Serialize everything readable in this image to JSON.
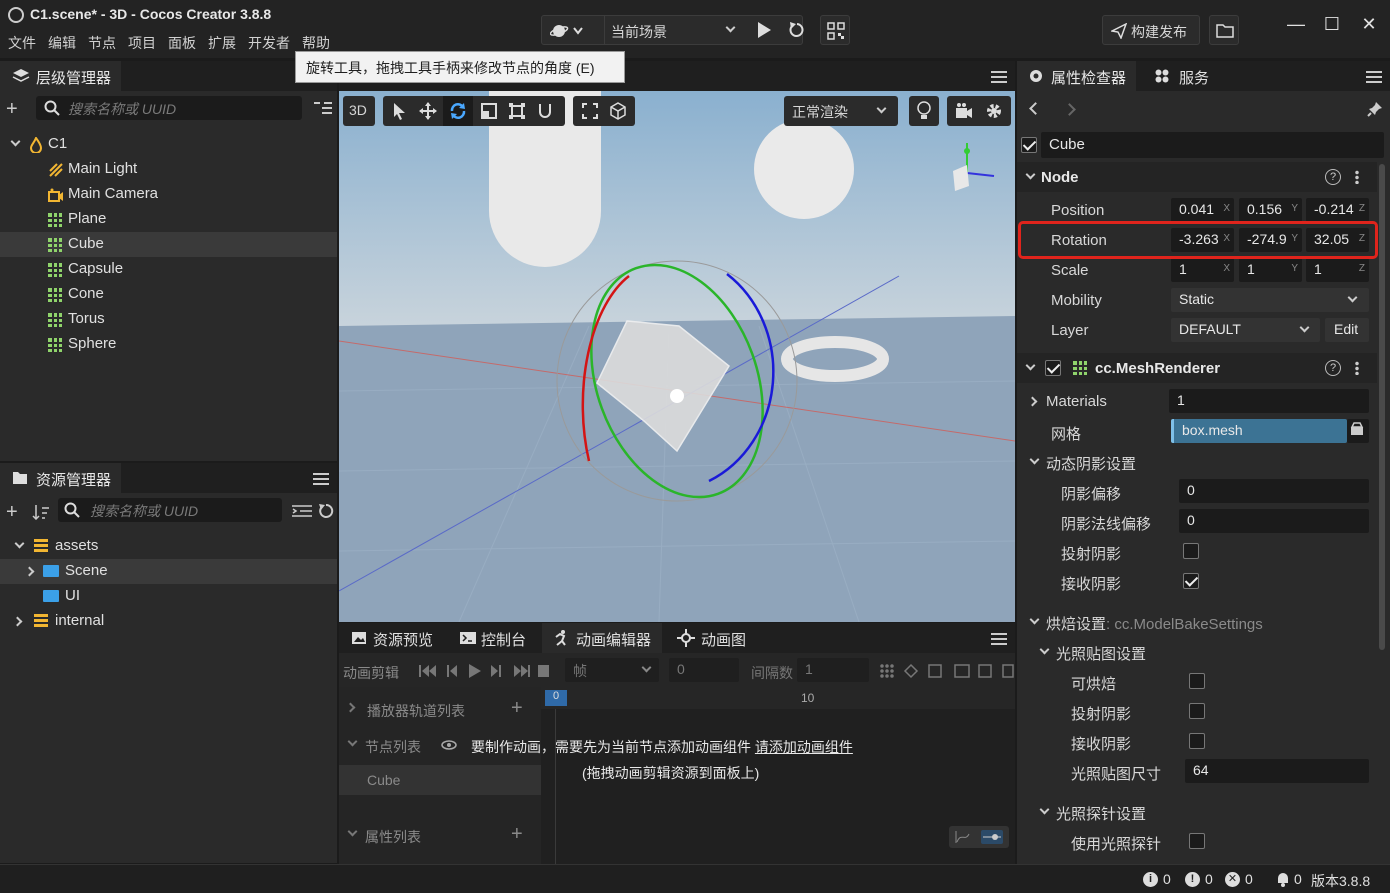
{
  "window": {
    "title": "C1.scene* - 3D - Cocos Creator 3.8.8",
    "menu": [
      "文件",
      "编辑",
      "节点",
      "项目",
      "面板",
      "扩展",
      "开发者",
      "帮助"
    ],
    "scene_select": "当前场景",
    "publish_label": "构建发布",
    "controls": {
      "minimize": "—",
      "maximize": "☐",
      "close": "✕"
    }
  },
  "tooltip": "旋转工具，拖拽工具手柄来修改节点的角度 (E)",
  "hierarchy": {
    "tab": "层级管理器",
    "search_placeholder": "搜索名称或 UUID",
    "root": "C1",
    "items": [
      "Main Light",
      "Main Camera",
      "Plane",
      "Cube",
      "Capsule",
      "Cone",
      "Torus",
      "Sphere"
    ],
    "selected": "Cube"
  },
  "assets": {
    "tab": "资源管理器",
    "search_placeholder": "搜索名称或 UUID",
    "items": [
      "assets",
      "Scene",
      "UI",
      "internal"
    ]
  },
  "scene_toolbar": {
    "mode_3d": "3D",
    "render_mode": "正常渲染"
  },
  "bottom_panel": {
    "tabs": [
      "资源预览",
      "控制台",
      "动画编辑器",
      "动画图"
    ],
    "active_tab": "动画编辑器",
    "clip_label": "动画剪辑",
    "frame_select": "帧",
    "frame_value": "0",
    "interval_label": "间隔数",
    "interval_value": "1",
    "ruler_marks": [
      "0",
      "10"
    ],
    "player_track_list": "播放器轨道列表",
    "node_list": "节点列表",
    "node_item": "Cube",
    "property_list": "属性列表",
    "message_prefix": "要制作动画，需要先为当前节点添加动画组件",
    "message_link": "请添加动画组件",
    "message_sub": "(拖拽动画剪辑资源到面板上)"
  },
  "inspector": {
    "tabs": [
      "属性检查器",
      "服务"
    ],
    "node_name": "Cube",
    "node_section": "Node",
    "position": {
      "label": "Position",
      "x": "0.041",
      "y": "0.156",
      "z": "-0.214"
    },
    "rotation": {
      "label": "Rotation",
      "x": "-3.263",
      "y": "-274.9",
      "z": "32.05"
    },
    "scale": {
      "label": "Scale",
      "x": "1",
      "y": "1",
      "z": "1"
    },
    "mobility": {
      "label": "Mobility",
      "value": "Static"
    },
    "layer": {
      "label": "Layer",
      "value": "DEFAULT",
      "edit": "Edit"
    },
    "mesh_renderer": "cc.MeshRenderer",
    "materials": {
      "label": "Materials",
      "value": "1"
    },
    "mesh": {
      "label": "网格",
      "value": "box.mesh"
    },
    "dynamic_shadow": {
      "label": "动态阴影设置",
      "shadow_bias": {
        "label": "阴影偏移",
        "value": "0"
      },
      "shadow_normal_bias": {
        "label": "阴影法线偏移",
        "value": "0"
      },
      "cast_shadow": {
        "label": "投射阴影",
        "checked": false
      },
      "receive_shadow": {
        "label": "接收阴影",
        "checked": true
      }
    },
    "bake": {
      "label": "烘焙设置",
      "type": ": cc.ModelBakeSettings",
      "lightmap": "光照贴图设置",
      "bakeable": "可烘焙",
      "cast_shadow": "投射阴影",
      "receive_shadow": "接收阴影",
      "lightmap_size": {
        "label": "光照贴图尺寸",
        "value": "64"
      },
      "probe": "光照探针设置",
      "use_probe": "使用光照探针"
    },
    "axis_labels": [
      "X",
      "Y",
      "Z"
    ]
  },
  "statusbar": {
    "info": "0",
    "warn": "0",
    "error": "0",
    "notify": "0",
    "version": "版本3.8.8"
  },
  "colors": {
    "accent": "#3b7bd5",
    "highlight_box": "#e0241c",
    "selected_row": "#3a3a3a"
  }
}
